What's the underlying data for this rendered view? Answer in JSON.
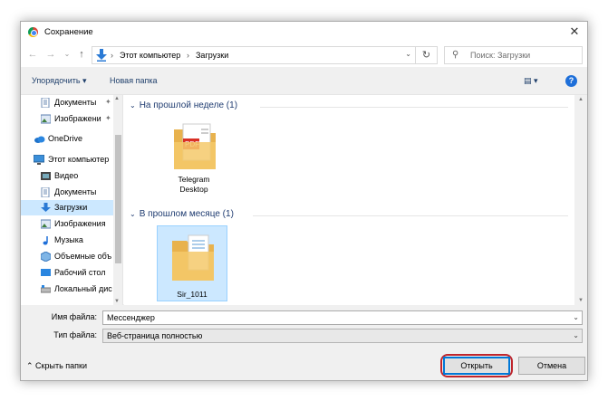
{
  "window": {
    "title": "Сохранение",
    "close_glyph": "✕"
  },
  "nav": {
    "back_glyph": "←",
    "forward_glyph": "→",
    "up_glyph": "↑",
    "breadcrumb": [
      "Этот компьютер",
      "Загрузки"
    ],
    "sep_glyph": "›",
    "dropdown_glyph": "⌄",
    "refresh_glyph": "↻"
  },
  "search": {
    "placeholder": "Поиск: Загрузки",
    "glyph": "⚲"
  },
  "toolbar": {
    "organize_label": "Упорядочить ▾",
    "new_folder_label": "Новая папка",
    "view_glyph": "▤ ▾",
    "help_glyph": "?"
  },
  "sidebar": {
    "items": [
      {
        "label": "Документы",
        "icon": "documents-icon",
        "pinned": true
      },
      {
        "label": "Изображени",
        "icon": "pictures-icon",
        "pinned": true
      },
      {
        "label": "OneDrive",
        "icon": "onedrive-icon"
      },
      {
        "label": "Этот компьютер",
        "icon": "computer-icon"
      },
      {
        "label": "Видео",
        "icon": "video-icon"
      },
      {
        "label": "Документы",
        "icon": "documents-icon"
      },
      {
        "label": "Загрузки",
        "icon": "downloads-icon",
        "selected": true
      },
      {
        "label": "Изображения",
        "icon": "pictures-icon"
      },
      {
        "label": "Музыка",
        "icon": "music-icon"
      },
      {
        "label": "Объемные объ",
        "icon": "3d-objects-icon"
      },
      {
        "label": "Рабочий стол",
        "icon": "desktop-icon"
      },
      {
        "label": "Локальный дис",
        "icon": "drive-icon"
      }
    ],
    "pin_glyph": "📌"
  },
  "files": {
    "groups": [
      {
        "heading": "На прошлой неделе (1)",
        "items": [
          {
            "name_line1": "Telegram",
            "name_line2": "Desktop"
          }
        ]
      },
      {
        "heading": "В прошлом месяце (1)",
        "items": [
          {
            "name_line1": "Sir_1011",
            "name_line2": ""
          }
        ]
      }
    ],
    "chevron_glyph": "⌄",
    "pdf_badge": "PDF"
  },
  "form": {
    "filename_label": "Имя файла:",
    "filename_value": "Мессенджер",
    "filetype_label": "Тип файла:",
    "filetype_value": "Веб-страница полностью",
    "dropdown_glyph": "⌄"
  },
  "footer": {
    "hide_folders_label": "⌃  Скрыть папки",
    "open_label": "Открыть",
    "cancel_label": "Отмена"
  },
  "colors": {
    "accent": "#0078d7",
    "selection": "#cce8ff",
    "highlight_ring": "#c0262c",
    "folder_yellow": "#f5c96b"
  }
}
